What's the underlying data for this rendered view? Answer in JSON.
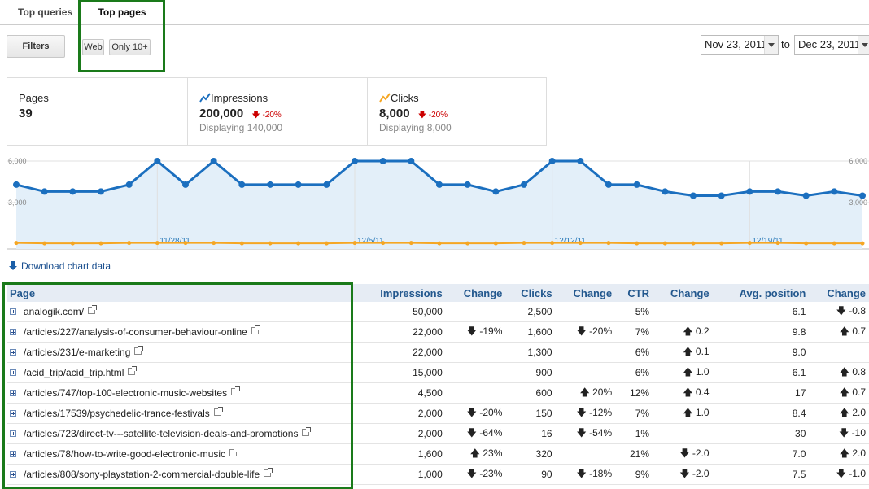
{
  "tabs": [
    {
      "label": "Top queries",
      "active": false
    },
    {
      "label": "Top pages",
      "active": true
    }
  ],
  "filters": {
    "filters_label": "Filters",
    "web_label": "Web",
    "only10_label": "Only 10+"
  },
  "dates": {
    "from": "Nov 23, 2011",
    "to_word": "to",
    "to": "Dec 23, 2011"
  },
  "stats": {
    "pages": {
      "label": "Pages",
      "value": "39"
    },
    "impressions": {
      "label": "Impressions",
      "value": "200,000",
      "change": "-20%",
      "sub": "Displaying 140,000"
    },
    "clicks": {
      "label": "Clicks",
      "value": "8,000",
      "change": "-20%",
      "sub": "Displaying 8,000"
    }
  },
  "chart_data": {
    "type": "line",
    "y_ticks_left": [
      "6,000",
      "3,000"
    ],
    "y_ticks_right": [
      "6,000",
      "3,000"
    ],
    "x_labels": [
      "11/28/11",
      "12/5/11",
      "12/12/11",
      "12/19/11"
    ],
    "ylim": [
      0,
      6000
    ],
    "series": [
      {
        "values": [
          4300,
          3800,
          3800,
          3800,
          4300,
          6000,
          4300,
          6000,
          4300,
          4300,
          4300,
          4300,
          6000,
          6000,
          6000,
          4300,
          4300,
          3800,
          4300,
          6000,
          6000,
          4300,
          4300,
          3800,
          3500,
          3500,
          3800,
          3800,
          3500,
          3800,
          3500
        ],
        "color": "#1b6fbf"
      },
      {
        "values": [
          80,
          50,
          50,
          50,
          80,
          80,
          80,
          80,
          50,
          50,
          50,
          50,
          80,
          80,
          80,
          50,
          50,
          50,
          80,
          80,
          80,
          80,
          50,
          50,
          50,
          50,
          80,
          80,
          50,
          50,
          50
        ],
        "color": "#f5a623"
      }
    ]
  },
  "download_label": "Download chart data",
  "table": {
    "headers": [
      "Page",
      "Impressions",
      "Change",
      "Clicks",
      "Change",
      "CTR",
      "Change",
      "Avg. position",
      "Change"
    ],
    "rows": [
      {
        "page": "analogik.com/",
        "impr": "50,000",
        "impr_chg": "",
        "clicks": "2,500",
        "clicks_chg": "",
        "ctr": "5%",
        "ctr_chg": "",
        "pos": "6.1",
        "pos_chg": "-0.8"
      },
      {
        "page": "/articles/227/analysis-of-consumer-behaviour-online",
        "impr": "22,000",
        "impr_chg": "-19%",
        "clicks": "1,600",
        "clicks_chg": "-20%",
        "ctr": "7%",
        "ctr_chg": "0.2",
        "pos": "9.8",
        "pos_chg": "0.7"
      },
      {
        "page": "/articles/231/e-marketing",
        "impr": "22,000",
        "impr_chg": "",
        "clicks": "1,300",
        "clicks_chg": "",
        "ctr": "6%",
        "ctr_chg": "0.1",
        "pos": "9.0",
        "pos_chg": ""
      },
      {
        "page": "/acid_trip/acid_trip.html",
        "impr": "15,000",
        "impr_chg": "",
        "clicks": "900",
        "clicks_chg": "",
        "ctr": "6%",
        "ctr_chg": "1.0",
        "pos": "6.1",
        "pos_chg": "0.8"
      },
      {
        "page": "/articles/747/top-100-electronic-music-websites",
        "impr": "4,500",
        "impr_chg": "",
        "clicks": "600",
        "clicks_chg": "20%",
        "ctr": "12%",
        "ctr_chg": "0.4",
        "pos": "17",
        "pos_chg": "0.7"
      },
      {
        "page": "/articles/17539/psychedelic-trance-festivals",
        "impr": "2,000",
        "impr_chg": "-20%",
        "clicks": "150",
        "clicks_chg": "-12%",
        "ctr": "7%",
        "ctr_chg": "1.0",
        "pos": "8.4",
        "pos_chg": "2.0"
      },
      {
        "page": "/articles/723/direct-tv---satellite-television-deals-and-promotions",
        "impr": "2,000",
        "impr_chg": "-64%",
        "clicks": "16",
        "clicks_chg": "-54%",
        "ctr": "1%",
        "ctr_chg": "",
        "pos": "30",
        "pos_chg": "-10"
      },
      {
        "page": "/articles/78/how-to-write-good-electronic-music",
        "impr": "1,600",
        "impr_chg": "23%",
        "clicks": "320",
        "clicks_chg": "",
        "ctr": "21%",
        "ctr_chg": "-2.0",
        "pos": "7.0",
        "pos_chg": "2.0"
      },
      {
        "page": "/articles/808/sony-playstation-2-commercial-double-life",
        "impr": "1,000",
        "impr_chg": "-23%",
        "clicks": "90",
        "clicks_chg": "-18%",
        "ctr": "9%",
        "ctr_chg": "-2.0",
        "pos": "7.5",
        "pos_chg": "-1.0"
      }
    ]
  }
}
